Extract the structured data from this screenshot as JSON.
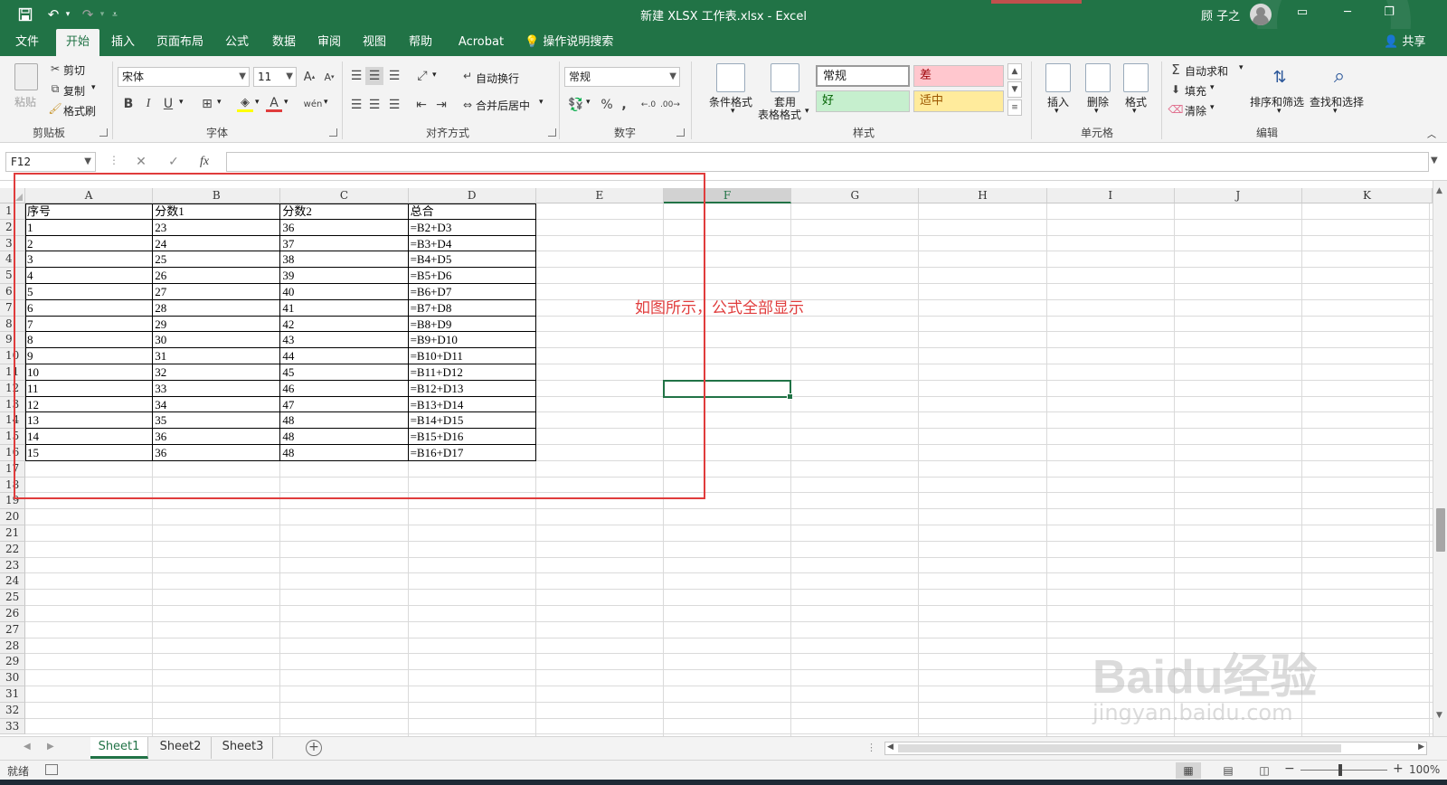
{
  "app": {
    "title": "新建 XLSX 工作表.xlsx - Excel",
    "user": "顾 子之",
    "accent": "#217346"
  },
  "quick_access": {
    "save_icon": "save-icon",
    "undo_icon": "undo-icon",
    "redo_icon": "redo-icon",
    "customize_icon": "customize-icon"
  },
  "window_buttons": {
    "ribbon_display": "ribbon-display-icon",
    "minimize": "minimize-icon",
    "restore": "restore-icon",
    "close": "close-icon"
  },
  "tabs": [
    "文件",
    "开始",
    "插入",
    "页面布局",
    "公式",
    "数据",
    "审阅",
    "视图",
    "帮助",
    "Acrobat"
  ],
  "active_tab": "开始",
  "tell_me": "操作说明搜索",
  "share": "共享",
  "ribbon": {
    "clipboard": {
      "paste": "粘贴",
      "cut": "剪切",
      "copy": "复制",
      "format_painter": "格式刷",
      "label": "剪贴板"
    },
    "font": {
      "name": "宋体",
      "size": "11",
      "bold": "B",
      "italic": "I",
      "underline": "U",
      "font_color_letter": "A",
      "phonetic": "wén",
      "label": "字体"
    },
    "alignment": {
      "wrap_text": "自动换行",
      "merge_center": "合并后居中",
      "label": "对齐方式"
    },
    "number": {
      "format": "常规",
      "percent": "%",
      "comma": ",",
      "label": "数字"
    },
    "styles": {
      "conditional_formatting": "条件格式",
      "format_as_table_line1": "套用",
      "format_as_table_line2": "表格格式",
      "normal": "常规",
      "bad": "差",
      "good": "好",
      "neutral": "适中",
      "label": "样式",
      "bad_color": "#ffc7ce",
      "good_color": "#c6efce",
      "neutral_color": "#ffeb9c"
    },
    "cells": {
      "insert": "插入",
      "delete": "删除",
      "format": "格式",
      "label": "单元格"
    },
    "editing": {
      "autosum": "自动求和",
      "fill": "填充",
      "clear": "清除",
      "sort_filter": "排序和筛选",
      "find_select": "查找和选择",
      "label": "编辑"
    }
  },
  "formula_bar": {
    "name_box": "F12",
    "fx": "fx",
    "cancel": "✕",
    "enter": "✓",
    "value": ""
  },
  "grid": {
    "columns": [
      "A",
      "B",
      "C",
      "D",
      "E",
      "F",
      "G",
      "H",
      "I",
      "J",
      "K"
    ],
    "selected_column": "F",
    "rows": [
      "1",
      "2",
      "3",
      "4",
      "5",
      "6",
      "7",
      "8",
      "9",
      "10",
      "11",
      "12",
      "13",
      "14",
      "15",
      "16",
      "17",
      "18",
      "19",
      "20",
      "21",
      "22",
      "23",
      "24",
      "25",
      "26",
      "27",
      "28",
      "29",
      "30",
      "31",
      "32",
      "33"
    ],
    "headers": [
      "序号",
      "分数1",
      "分数2",
      "总合"
    ],
    "data": [
      [
        "1",
        "23",
        "36",
        "=B2+D3"
      ],
      [
        "2",
        "24",
        "37",
        "=B3+D4"
      ],
      [
        "3",
        "25",
        "38",
        "=B4+D5"
      ],
      [
        "4",
        "26",
        "39",
        "=B5+D6"
      ],
      [
        "5",
        "27",
        "40",
        "=B6+D7"
      ],
      [
        "6",
        "28",
        "41",
        "=B7+D8"
      ],
      [
        "7",
        "29",
        "42",
        "=B8+D9"
      ],
      [
        "8",
        "30",
        "43",
        "=B9+D10"
      ],
      [
        "9",
        "31",
        "44",
        "=B10+D11"
      ],
      [
        "10",
        "32",
        "45",
        "=B11+D12"
      ],
      [
        "11",
        "33",
        "46",
        "=B12+D13"
      ],
      [
        "12",
        "34",
        "47",
        "=B13+D14"
      ],
      [
        "13",
        "35",
        "48",
        "=B14+D15"
      ],
      [
        "14",
        "36",
        "48",
        "=B15+D16"
      ],
      [
        "15",
        "36",
        "48",
        "=B16+D17"
      ]
    ],
    "annotation": "如图所示，公式全部显示",
    "annotation_color": "#e03c3c"
  },
  "sheets": [
    "Sheet1",
    "Sheet2",
    "Sheet3"
  ],
  "active_sheet": "Sheet1",
  "status": {
    "ready": "就绪",
    "zoom": "100%"
  },
  "watermark": {
    "brand": "Baidu经验",
    "url": "jingyan.baidu.com"
  }
}
